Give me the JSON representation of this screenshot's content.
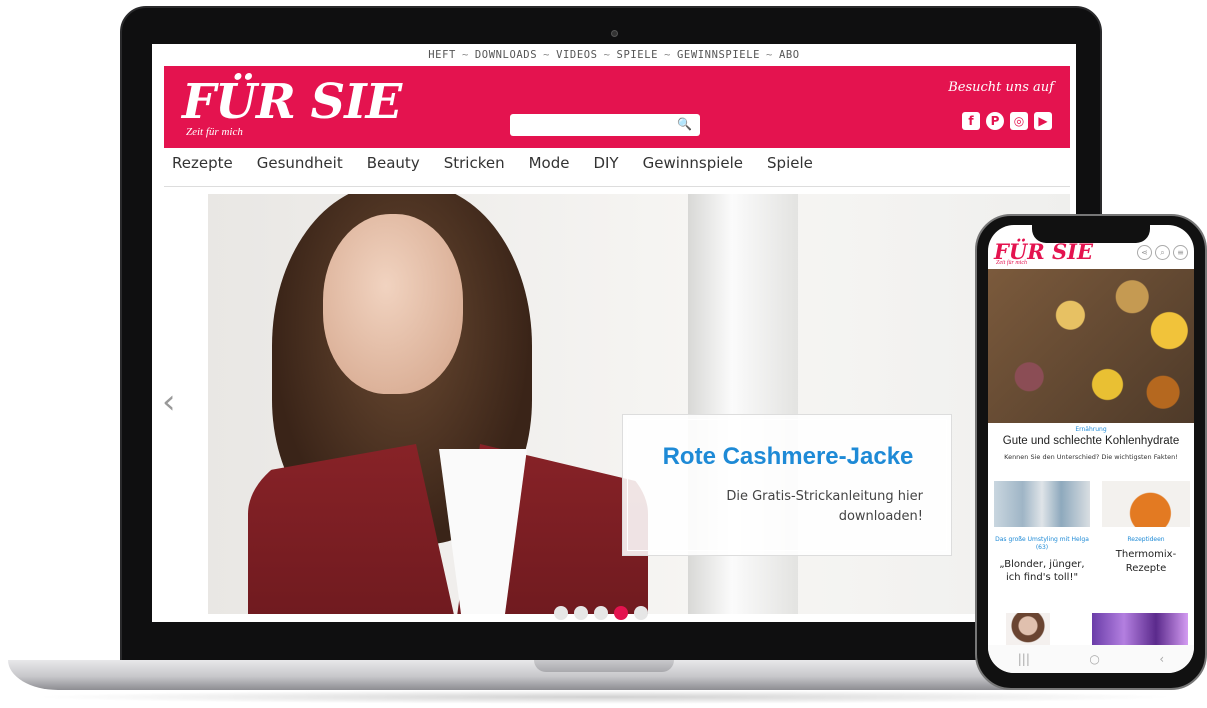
{
  "laptop": {
    "topnav": [
      "HEFT",
      "DOWNLOADS",
      "VIDEOS",
      "SPIELE",
      "GEWINNSPIELE",
      "ABO"
    ],
    "topnav_sep": "~",
    "logo": "FÜR SIE",
    "logo_tagline": "Zeit für mich",
    "follow_text": "Besucht uns auf",
    "social": [
      "facebook-icon",
      "pinterest-icon",
      "instagram-icon",
      "youtube-icon"
    ],
    "social_glyphs": [
      "f",
      "P",
      "◎",
      "▶"
    ],
    "search_icon": "🔍",
    "main_nav": [
      "Rezepte",
      "Gesundheit",
      "Beauty",
      "Stricken",
      "Mode",
      "DIY",
      "Gewinnspiele",
      "Spiele"
    ],
    "hero": {
      "arrow_left": "‹",
      "title": "Rote Cashmere-Jacke",
      "text": "Die Gratis-Strickanleitung hier downloaden!",
      "dots": 5,
      "active_dot": 4
    },
    "colors": {
      "brand": "#e4134f",
      "accent": "#1e8ad6"
    }
  },
  "phone": {
    "logo": "FÜR SIE",
    "logo_tagline": "Zeit für mich",
    "header_icons": [
      "⋖",
      "⌕",
      "≡"
    ],
    "article": {
      "category": "Ernährung",
      "title": "Gute und schlechte Kohlenhydrate",
      "subtitle": "Kennen Sie den Unterschied? Die wichtigsten Fakten!"
    },
    "card1": {
      "category": "Das große Umstyling mit Helga (63)",
      "title": "„Blonder, jünger, ich find's toll!\""
    },
    "card2": {
      "category": "Rezeptideen",
      "title": "Thermomix-Rezepte"
    },
    "bottom_bar": [
      "|||",
      "○",
      "‹"
    ]
  }
}
